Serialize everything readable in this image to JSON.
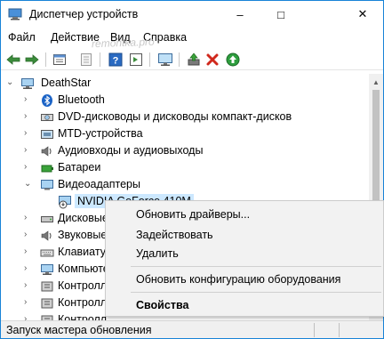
{
  "window": {
    "title": "Диспетчер устройств",
    "controls": {
      "minimize": "–",
      "maximize": "□",
      "close": "✕"
    }
  },
  "menu": [
    "Файл",
    "Действие",
    "Вид",
    "Справка"
  ],
  "watermark": "remontka.pro",
  "toolbar": [
    "back-arrow-icon",
    "forward-arrow-icon",
    "properties-icon",
    "disabled-properties-icon",
    "help-icon",
    "view-icon",
    "monitor-icon",
    "update-driver-icon",
    "uninstall-icon",
    "enable-icon"
  ],
  "tree": {
    "root": "DeathStar",
    "items": [
      {
        "label": "Bluetooth",
        "icon": "bluetooth-icon",
        "expanded": false
      },
      {
        "label": "DVD-дисководы и дисководы компакт-дисков",
        "icon": "dvd-drive-icon",
        "expanded": false
      },
      {
        "label": "MTD-устройства",
        "icon": "mtd-device-icon",
        "expanded": false
      },
      {
        "label": "Аудиовходы и аудиовыходы",
        "icon": "audio-icon",
        "expanded": false
      },
      {
        "label": "Батареи",
        "icon": "battery-icon",
        "expanded": false
      },
      {
        "label": "Видеоадаптеры",
        "icon": "display-adapter-icon",
        "expanded": true
      },
      {
        "label": "NVIDIA GeForce 410M",
        "icon": "gpu-warning-icon",
        "child": true,
        "selected": true
      },
      {
        "label": "Дисковые",
        "icon": "disk-icon",
        "expanded": false
      },
      {
        "label": "Звуковые",
        "icon": "sound-icon",
        "expanded": false
      },
      {
        "label": "Клавиатур",
        "icon": "keyboard-icon",
        "expanded": false
      },
      {
        "label": "Компьюте",
        "icon": "computer-icon",
        "expanded": false
      },
      {
        "label": "Контролл",
        "icon": "controller-icon",
        "expanded": false
      },
      {
        "label": "Контролл",
        "icon": "controller-icon",
        "expanded": false
      },
      {
        "label": "Контролл",
        "icon": "controller-icon",
        "expanded": false
      }
    ]
  },
  "context_menu": {
    "update_driver": "Обновить драйверы...",
    "enable": "Задействовать",
    "uninstall": "Удалить",
    "scan": "Обновить конфигурацию оборудования",
    "properties": "Свойства"
  },
  "status": "Запуск мастера обновления",
  "colors": {
    "accent": "#1883d7",
    "selection": "#cce8ff",
    "menu_bg": "#f2f2f2"
  }
}
